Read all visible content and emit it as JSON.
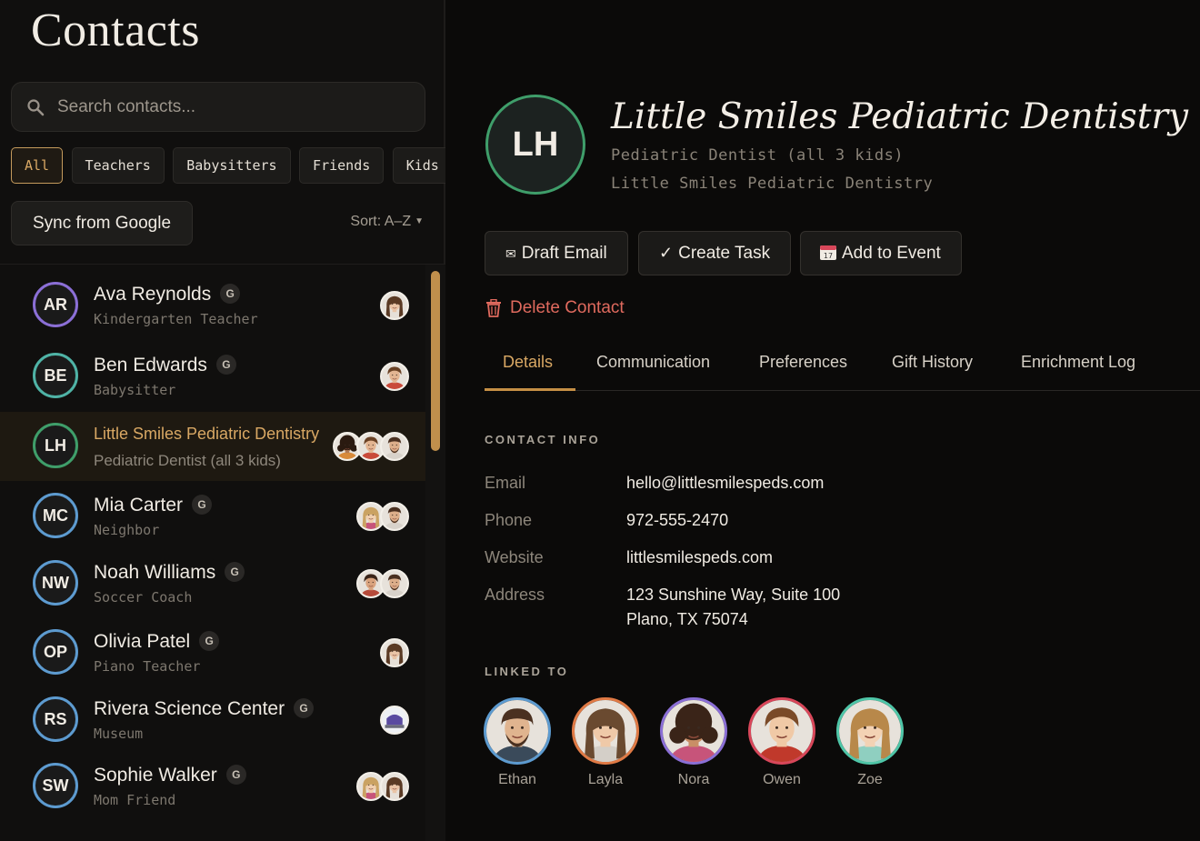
{
  "app": {
    "title": "Contacts"
  },
  "search": {
    "placeholder": "Search contacts..."
  },
  "filters": [
    "All",
    "Teachers",
    "Babysitters",
    "Friends",
    "Kids"
  ],
  "sync_label": "Sync from Google",
  "sort_label": "Sort: A–Z",
  "contacts": [
    {
      "initials": "AR",
      "name": "Ava Reynolds",
      "role": "Kindergarten Teacher",
      "badge": "G",
      "ring": "#8b6fd6"
    },
    {
      "initials": "BE",
      "name": "Ben Edwards",
      "role": "Babysitter",
      "badge": "G",
      "ring": "#4fb3a6"
    },
    {
      "initials": "LH",
      "name": "Little Smiles Pediatric Dentistry",
      "role": "Pediatric Dentist (all 3 kids)",
      "badge": "",
      "ring": "#3f9e6a"
    },
    {
      "initials": "MC",
      "name": "Mia Carter",
      "role": "Neighbor",
      "badge": "G",
      "ring": "#5d9bd0"
    },
    {
      "initials": "NW",
      "name": "Noah Williams",
      "role": "Soccer Coach",
      "badge": "G",
      "ring": "#5d9bd0"
    },
    {
      "initials": "OP",
      "name": "Olivia Patel",
      "role": "Piano Teacher",
      "badge": "G",
      "ring": "#5d9bd0"
    },
    {
      "initials": "RS",
      "name": "Rivera Science Center",
      "role": "Museum",
      "badge": "G",
      "ring": "#5d9bd0"
    },
    {
      "initials": "SW",
      "name": "Sophie Walker",
      "role": "Mom Friend",
      "badge": "G",
      "ring": "#5d9bd0"
    }
  ],
  "detail": {
    "initials": "LH",
    "title": "Little Smiles Pediatric Dentistry",
    "subtitle": "Pediatric Dentist (all 3 kids)",
    "organization": "Little Smiles Pediatric Dentistry",
    "actions": {
      "email": "Draft Email",
      "task": "Create Task",
      "event": "Add to Event"
    },
    "delete_label": "Delete Contact",
    "tabs": [
      "Details",
      "Communication",
      "Preferences",
      "Gift History",
      "Enrichment Log"
    ],
    "contact_info_label": "CONTACT INFO",
    "fields": {
      "email_label": "Email",
      "email": "hello@littlesmilespeds.com",
      "phone_label": "Phone",
      "phone": "972-555-2470",
      "website_label": "Website",
      "website": "littlesmilespeds.com",
      "address_label": "Address",
      "address_line1": "123 Sunshine Way, Suite 100",
      "address_line2": "Plano, TX 75074"
    },
    "linked_label": "LINKED TO",
    "linked": [
      {
        "name": "Ethan",
        "ring": "#5d9bd0"
      },
      {
        "name": "Layla",
        "ring": "#e07a45"
      },
      {
        "name": "Nora",
        "ring": "#8b6fd6"
      },
      {
        "name": "Owen",
        "ring": "#d9475a"
      },
      {
        "name": "Zoe",
        "ring": "#4fc6a8"
      }
    ]
  },
  "colors": {
    "accent": "#d9a864",
    "danger": "#e06a5e",
    "selected_bg": "#1e1911"
  }
}
